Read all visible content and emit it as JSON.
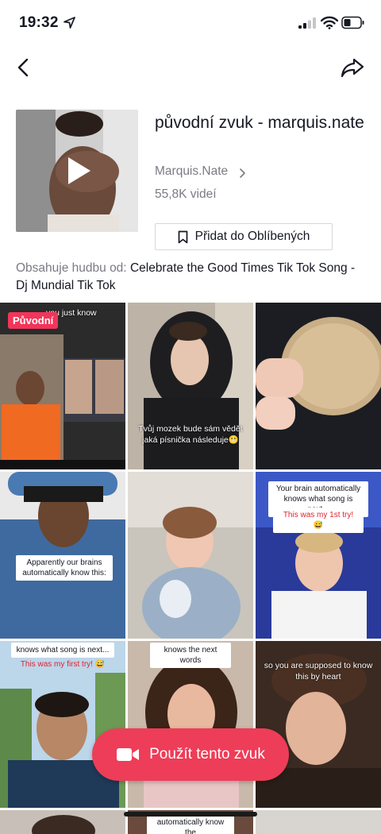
{
  "status_bar": {
    "time": "19:32"
  },
  "sound": {
    "title": "původní zvuk - marquis.nate",
    "artist": "Marquis.Nate",
    "video_count": "55,8K videí",
    "favorite_label": "Přidat do Oblíbených",
    "contains_prefix": "Obsahuje hudbu od:",
    "contains_song": "Celebrate the Good Times Tik Tok Song - Dj Mundial Tik Tok"
  },
  "grid": {
    "badge": "Původní",
    "tile1_top_text": "you just know",
    "tile2_caption": "Tvůj mozek bude sám vědět jaká písnička následuje😬",
    "tile4_caption": "Apparently our brains automatically know this:",
    "tile6_caption": "Your brain automatically knows what song is next...",
    "tile6_caption_red": "This was my 1st try! 😅",
    "tile7_caption": "knows what song is next...",
    "tile7_caption_red": "This was my first try! 😅",
    "tile8_caption": "knows the next words",
    "tile9_caption": "so you are supposed to know this by heart",
    "tile11_caption": "automatically know the"
  },
  "action": {
    "use_sound_label": "Použít tento zvuk"
  },
  "colors": {
    "accent": "#ee3d58",
    "badge": "#f2355a",
    "secondary_text": "#7a7b84"
  }
}
